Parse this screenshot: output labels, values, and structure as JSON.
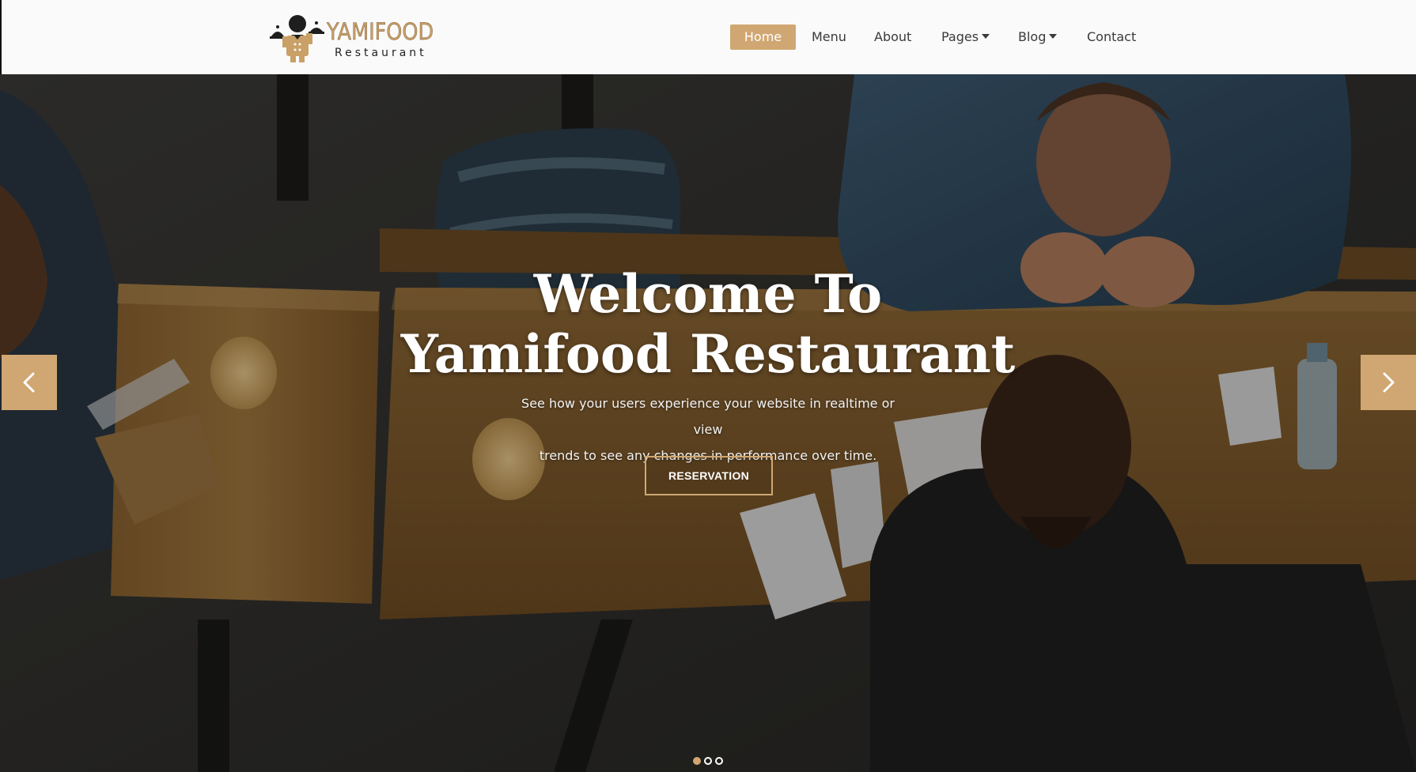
{
  "brand": {
    "name": "YAMIFOOD",
    "tagline": "Restaurant",
    "accent_color": "#d0a772",
    "logo_icon": "chef-with-cloche-logo"
  },
  "nav": {
    "items": [
      {
        "label": "Home",
        "active": true,
        "dropdown": false
      },
      {
        "label": "Menu",
        "active": false,
        "dropdown": false
      },
      {
        "label": "About",
        "active": false,
        "dropdown": false
      },
      {
        "label": "Pages",
        "active": false,
        "dropdown": true
      },
      {
        "label": "Blog",
        "active": false,
        "dropdown": true
      },
      {
        "label": "Contact",
        "active": false,
        "dropdown": false
      }
    ]
  },
  "hero": {
    "title_line1": "Welcome To",
    "title_line2": "Yamifood Restaurant",
    "subtitle_line1": "See how your users experience your website in realtime or view",
    "subtitle_line2": "trends to see any changes in performance over time.",
    "cta_label": "RESERVATION",
    "prev_icon": "chevron-left-icon",
    "next_icon": "chevron-right-icon",
    "slides_total": 3,
    "active_slide": 1
  }
}
